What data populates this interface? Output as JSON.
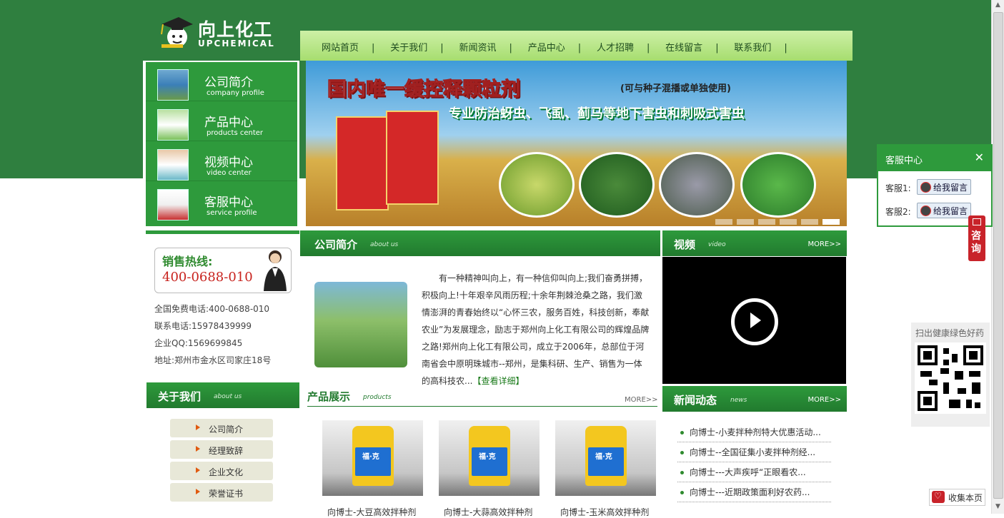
{
  "brand": {
    "name_cn": "向上化工",
    "name_en": "UPCHEMICAL"
  },
  "nav": {
    "items": [
      "网站首页",
      "关于我们",
      "新闻资讯",
      "产品中心",
      "人才招聘",
      "在线留言",
      "联系我们"
    ],
    "separator": "|"
  },
  "side_menu": {
    "items": [
      {
        "title": "公司简介",
        "sub": "company profile"
      },
      {
        "title": "产品中心",
        "sub": "products center"
      },
      {
        "title": "视频中心",
        "sub": "video center"
      },
      {
        "title": "客服中心",
        "sub": "service profile"
      }
    ]
  },
  "banner": {
    "headline": "国内唯一缓控释颗粒剂",
    "headline_note": "(可与种子混播或单独使用)",
    "subline": "专业防治蚜虫、飞虱、蓟马等地下害虫和刺吸式害虫",
    "slides_count": 6,
    "active_slide": 6
  },
  "hotline": {
    "label": "销售热线:",
    "number": "400-0688-010"
  },
  "contact": {
    "free_phone": "全国免费电话:400-0688-010",
    "phone": "联系电话:15978439999",
    "qq": "企业QQ:1569699845",
    "address": "地址:郑州市金水区司家庄18号"
  },
  "about": {
    "title": "关于我们",
    "title_en": "about us",
    "links": [
      "公司简介",
      "经理致辞",
      "企业文化",
      "荣誉证书"
    ]
  },
  "intro": {
    "title": "公司简介",
    "title_en": "about us",
    "text": "有一种精神叫向上，有一种信仰叫向上;我们奋勇拼搏，积极向上!十年艰辛风雨历程;十余年荆棘沧桑之路，我们激情澎湃的青春始终以“心怀三农，服务百姓，科技创新，奉献农业”为发展理念，励志于郑州向上化工有限公司的辉煌品牌之路!郑州向上化工有限公司，成立于2006年，总部位于河南省会中原明珠城市--郑州，是集科研、生产、销售为一体的高科技农...",
    "more": "【查看详细】"
  },
  "products": {
    "title": "产品展示",
    "title_en": "products",
    "more": "MORE>>",
    "items": [
      {
        "caption": "向博士-大豆高效拌种剂",
        "bottle_label": "福·克"
      },
      {
        "caption": "向博士-大蒜高效拌种剂",
        "bottle_label": "福·克"
      },
      {
        "caption": "向博士-玉米高效拌种剂",
        "bottle_label": "福·克"
      }
    ]
  },
  "video": {
    "title": "视频",
    "title_en": "video",
    "more": "MORE>>"
  },
  "news": {
    "title": "新闻动态",
    "title_en": "news",
    "more": "MORE>>",
    "items": [
      "向博士-小麦拌种剂特大优惠活动...",
      "向博士--全国征集小麦拌种剂经...",
      "向博士---大声疾呼“正眼看农...",
      "向博士---近期政策面利好农药..."
    ]
  },
  "service_panel": {
    "title": "客服中心",
    "close": "✕",
    "rows": [
      {
        "label": "客服1:",
        "button": "给我留言"
      },
      {
        "label": "客服2:",
        "button": "给我留言"
      }
    ]
  },
  "consult": {
    "label": "咨询"
  },
  "qr": {
    "label": "扫出健康绿色好药"
  },
  "favorite": {
    "label": "收集本页",
    "icon": "heart-icon"
  },
  "colors": {
    "brand_green": "#2f7f3f",
    "nav_green": "#a6dd6f",
    "accent_red": "#c8232a"
  }
}
